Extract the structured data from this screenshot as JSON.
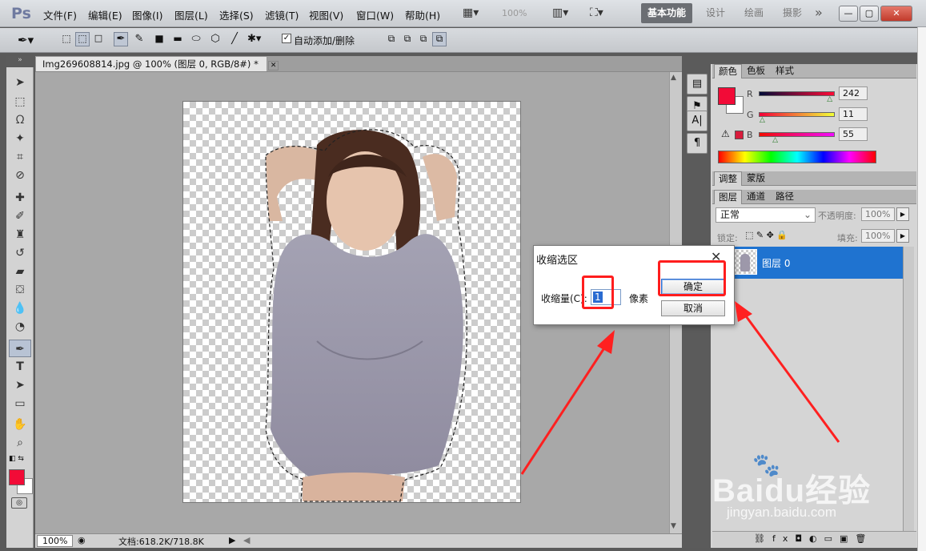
{
  "app": {
    "logo": "Ps"
  },
  "menu": [
    "文件(F)",
    "编辑(E)",
    "图像(I)",
    "图层(L)",
    "选择(S)",
    "滤镜(T)",
    "视图(V)",
    "窗口(W)",
    "帮助(H)"
  ],
  "zoom_display": "100%",
  "workspaces": [
    "基本功能",
    "设计",
    "绘画",
    "摄影"
  ],
  "more_label": "»",
  "options": {
    "auto_add_delete": "自动添加/删除"
  },
  "document": {
    "tab_title": "Img269608814.jpg @ 100% (图层 0, RGB/8#) *",
    "zoom": "100%",
    "doc_size": "文档:618.2K/718.8K"
  },
  "color_panel": {
    "tabs": [
      "颜色",
      "色板",
      "样式"
    ],
    "r_label": "R",
    "g_label": "G",
    "b_label": "B",
    "r": "242",
    "g": "11",
    "b": "55",
    "r_level": 0.949,
    "g_level": 0.043,
    "b_level": 0.216,
    "fg_color": "#f20b37"
  },
  "adjust_panel": {
    "tabs": [
      "调整",
      "蒙版"
    ]
  },
  "layers_panel": {
    "tabs": [
      "图层",
      "通道",
      "路径"
    ],
    "blend_mode": "正常",
    "opacity_label": "不透明度:",
    "opacity": "100%",
    "lock_label": "锁定:",
    "fill_label": "填充:",
    "fill": "100%",
    "layer_name": "图层 0"
  },
  "dialog": {
    "title": "收缩选区",
    "label": "收缩量(C):",
    "value": "1",
    "unit": "像素",
    "ok": "确定",
    "cancel": "取消"
  },
  "watermark": {
    "brand": "Baidu经验",
    "url": "jingyan.baidu.com"
  }
}
